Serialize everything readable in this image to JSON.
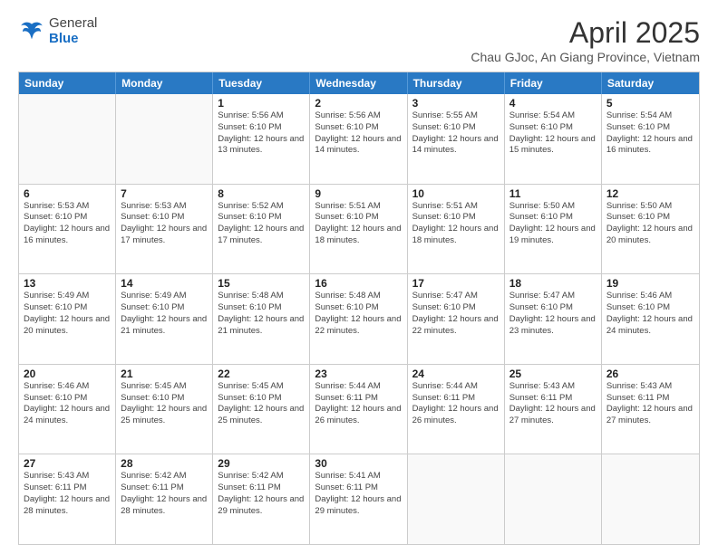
{
  "header": {
    "logo_general": "General",
    "logo_blue": "Blue",
    "title": "April 2025",
    "subtitle": "Chau GJoc, An Giang Province, Vietnam"
  },
  "days_of_week": [
    "Sunday",
    "Monday",
    "Tuesday",
    "Wednesday",
    "Thursday",
    "Friday",
    "Saturday"
  ],
  "weeks": [
    [
      {
        "day": "",
        "empty": true
      },
      {
        "day": "",
        "empty": true
      },
      {
        "day": "1",
        "info": "Sunrise: 5:56 AM\nSunset: 6:10 PM\nDaylight: 12 hours and 13 minutes."
      },
      {
        "day": "2",
        "info": "Sunrise: 5:56 AM\nSunset: 6:10 PM\nDaylight: 12 hours and 14 minutes."
      },
      {
        "day": "3",
        "info": "Sunrise: 5:55 AM\nSunset: 6:10 PM\nDaylight: 12 hours and 14 minutes."
      },
      {
        "day": "4",
        "info": "Sunrise: 5:54 AM\nSunset: 6:10 PM\nDaylight: 12 hours and 15 minutes."
      },
      {
        "day": "5",
        "info": "Sunrise: 5:54 AM\nSunset: 6:10 PM\nDaylight: 12 hours and 16 minutes."
      }
    ],
    [
      {
        "day": "6",
        "info": "Sunrise: 5:53 AM\nSunset: 6:10 PM\nDaylight: 12 hours and 16 minutes."
      },
      {
        "day": "7",
        "info": "Sunrise: 5:53 AM\nSunset: 6:10 PM\nDaylight: 12 hours and 17 minutes."
      },
      {
        "day": "8",
        "info": "Sunrise: 5:52 AM\nSunset: 6:10 PM\nDaylight: 12 hours and 17 minutes."
      },
      {
        "day": "9",
        "info": "Sunrise: 5:51 AM\nSunset: 6:10 PM\nDaylight: 12 hours and 18 minutes."
      },
      {
        "day": "10",
        "info": "Sunrise: 5:51 AM\nSunset: 6:10 PM\nDaylight: 12 hours and 18 minutes."
      },
      {
        "day": "11",
        "info": "Sunrise: 5:50 AM\nSunset: 6:10 PM\nDaylight: 12 hours and 19 minutes."
      },
      {
        "day": "12",
        "info": "Sunrise: 5:50 AM\nSunset: 6:10 PM\nDaylight: 12 hours and 20 minutes."
      }
    ],
    [
      {
        "day": "13",
        "info": "Sunrise: 5:49 AM\nSunset: 6:10 PM\nDaylight: 12 hours and 20 minutes."
      },
      {
        "day": "14",
        "info": "Sunrise: 5:49 AM\nSunset: 6:10 PM\nDaylight: 12 hours and 21 minutes."
      },
      {
        "day": "15",
        "info": "Sunrise: 5:48 AM\nSunset: 6:10 PM\nDaylight: 12 hours and 21 minutes."
      },
      {
        "day": "16",
        "info": "Sunrise: 5:48 AM\nSunset: 6:10 PM\nDaylight: 12 hours and 22 minutes."
      },
      {
        "day": "17",
        "info": "Sunrise: 5:47 AM\nSunset: 6:10 PM\nDaylight: 12 hours and 22 minutes."
      },
      {
        "day": "18",
        "info": "Sunrise: 5:47 AM\nSunset: 6:10 PM\nDaylight: 12 hours and 23 minutes."
      },
      {
        "day": "19",
        "info": "Sunrise: 5:46 AM\nSunset: 6:10 PM\nDaylight: 12 hours and 24 minutes."
      }
    ],
    [
      {
        "day": "20",
        "info": "Sunrise: 5:46 AM\nSunset: 6:10 PM\nDaylight: 12 hours and 24 minutes."
      },
      {
        "day": "21",
        "info": "Sunrise: 5:45 AM\nSunset: 6:10 PM\nDaylight: 12 hours and 25 minutes."
      },
      {
        "day": "22",
        "info": "Sunrise: 5:45 AM\nSunset: 6:10 PM\nDaylight: 12 hours and 25 minutes."
      },
      {
        "day": "23",
        "info": "Sunrise: 5:44 AM\nSunset: 6:11 PM\nDaylight: 12 hours and 26 minutes."
      },
      {
        "day": "24",
        "info": "Sunrise: 5:44 AM\nSunset: 6:11 PM\nDaylight: 12 hours and 26 minutes."
      },
      {
        "day": "25",
        "info": "Sunrise: 5:43 AM\nSunset: 6:11 PM\nDaylight: 12 hours and 27 minutes."
      },
      {
        "day": "26",
        "info": "Sunrise: 5:43 AM\nSunset: 6:11 PM\nDaylight: 12 hours and 27 minutes."
      }
    ],
    [
      {
        "day": "27",
        "info": "Sunrise: 5:43 AM\nSunset: 6:11 PM\nDaylight: 12 hours and 28 minutes."
      },
      {
        "day": "28",
        "info": "Sunrise: 5:42 AM\nSunset: 6:11 PM\nDaylight: 12 hours and 28 minutes."
      },
      {
        "day": "29",
        "info": "Sunrise: 5:42 AM\nSunset: 6:11 PM\nDaylight: 12 hours and 29 minutes."
      },
      {
        "day": "30",
        "info": "Sunrise: 5:41 AM\nSunset: 6:11 PM\nDaylight: 12 hours and 29 minutes."
      },
      {
        "day": "",
        "empty": true
      },
      {
        "day": "",
        "empty": true
      },
      {
        "day": "",
        "empty": true
      }
    ]
  ]
}
